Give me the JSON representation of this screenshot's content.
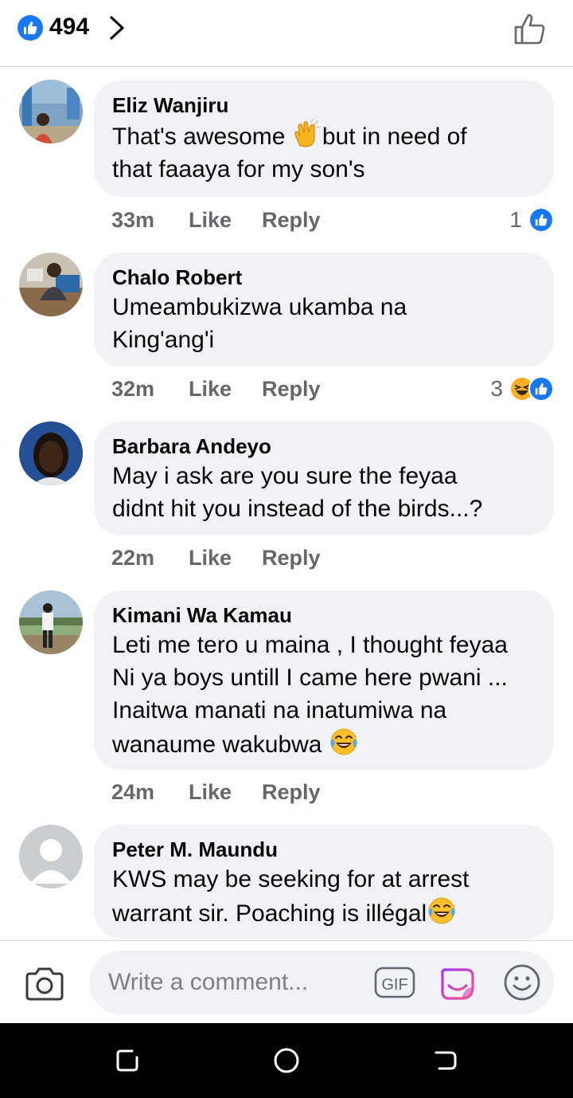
{
  "reactions_bar": {
    "total_count": "494",
    "like_icon": "like-icon",
    "chevron_icon": "chevron-right-icon",
    "thumb_icon": "thumbs-up-outline-icon"
  },
  "comments": [
    {
      "author": "Eliz Wanjiru",
      "lines": [
        "That's awesome ",
        "but in need of",
        "that faaaya for my son's"
      ],
      "emoji": "clapping-hands-emoji",
      "time": "33m",
      "like_label": "Like",
      "reply_label": "Reply",
      "reaction_count": "1",
      "reactions": [
        "like"
      ]
    },
    {
      "author": "Chalo Robert",
      "lines": [
        "Umeambukizwa ukamba na",
        "King'ang'i"
      ],
      "time": "32m",
      "like_label": "Like",
      "reply_label": "Reply",
      "reaction_count": "3",
      "reactions": [
        "haha",
        "like"
      ]
    },
    {
      "author": "Barbara Andeyo",
      "lines": [
        "May i ask are you sure the feyaa",
        "didnt hit you instead of the birds...?"
      ],
      "time": "22m",
      "like_label": "Like",
      "reply_label": "Reply"
    },
    {
      "author": "Kimani Wa Kamau",
      "lines": [
        "Leti me tero u maina , I thought feyaa",
        "Ni ya boys untill I came here pwani ...",
        "Inaitwa manati na inatumiwa na",
        "wanaume wakubwa "
      ],
      "emoji": "tears-of-joy-emoji",
      "time": "24m",
      "like_label": "Like",
      "reply_label": "Reply"
    },
    {
      "author": "Peter M. Maundu",
      "lines": [
        "KWS may be seeking for at arrest",
        "warrant sir. Poaching is illégal"
      ],
      "emoji": "tears-of-joy-emoji"
    }
  ],
  "composer": {
    "placeholder": "Write a comment...",
    "gif_label": "GIF"
  },
  "colors": {
    "brand_blue": "#1877f2",
    "bubble_bg": "#f0f2f5",
    "meta_gray": "#65676b",
    "haha_yellow": "#f7b125"
  }
}
